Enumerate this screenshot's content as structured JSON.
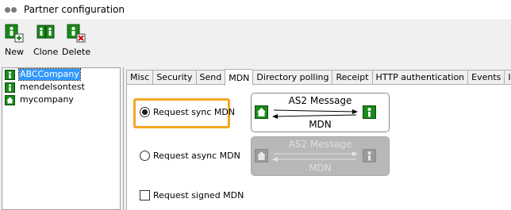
{
  "window": {
    "title": "Partner configuration"
  },
  "toolbar": {
    "new_label": "New",
    "clone_label": "Clone",
    "delete_label": "Delete"
  },
  "tree": {
    "items": [
      {
        "label": "ABCCompany",
        "icon": "remote-partner-icon",
        "selected": true
      },
      {
        "label": "mendelsontest",
        "icon": "remote-partner-icon",
        "selected": false
      },
      {
        "label": "mycompany",
        "icon": "local-station-icon",
        "selected": false
      }
    ]
  },
  "tabs": [
    {
      "label": "Misc"
    },
    {
      "label": "Security"
    },
    {
      "label": "Send"
    },
    {
      "label": "MDN",
      "active": true
    },
    {
      "label": "Directory polling"
    },
    {
      "label": "Receipt"
    },
    {
      "label": "HTTP authentication"
    },
    {
      "label": "Events"
    },
    {
      "label": "Info"
    }
  ],
  "mdn": {
    "sync_label": "Request sync MDN",
    "sync_checked": true,
    "async_label": "Request async MDN",
    "async_checked": false,
    "signed_label": "Request signed MDN",
    "signed_checked": false
  },
  "diagram_sync": {
    "top": "AS2 Message",
    "bottom": "MDN",
    "enabled": true
  },
  "diagram_async": {
    "top": "AS2 Message",
    "bottom": "MDN",
    "enabled": false
  },
  "colors": {
    "icon_green": "#1a8a1a",
    "highlight": "#f5a623",
    "selection": "#3399ff"
  }
}
